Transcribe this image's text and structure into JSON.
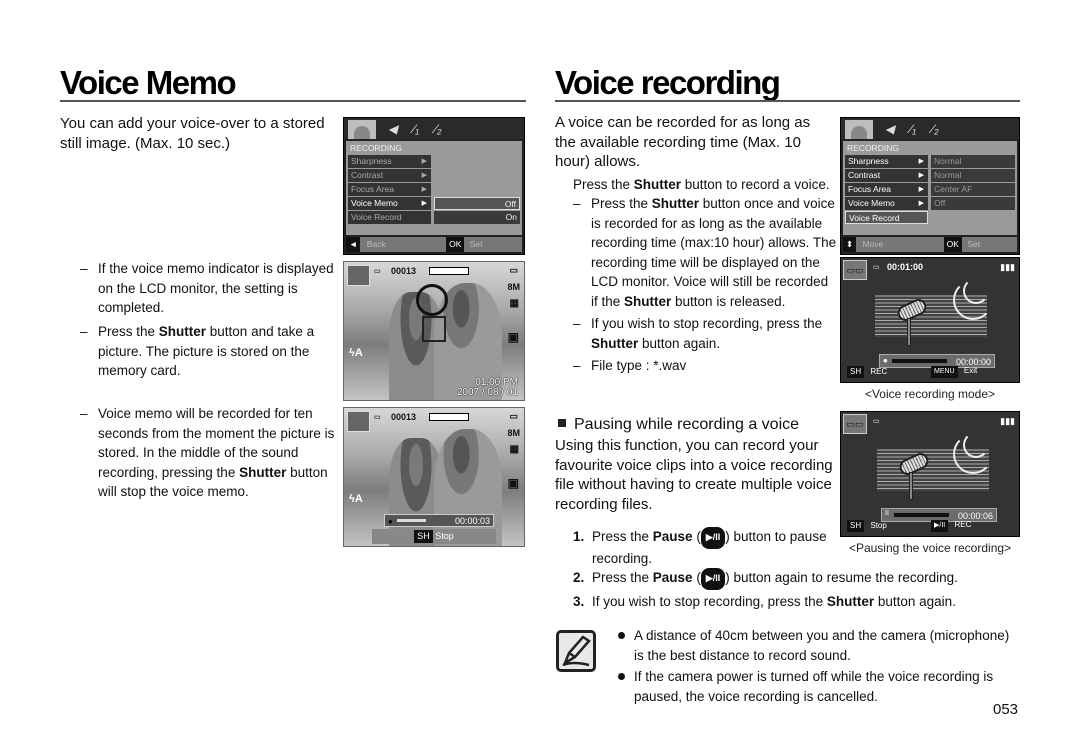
{
  "left": {
    "title": "Voice Memo",
    "intro": "You can add your voice-over to a stored still image. (Max. 10 sec.)",
    "items": [
      {
        "parts": [
          {
            "t": "If the voice memo indicator is displayed on the LCD monitor, the setting is completed."
          }
        ]
      },
      {
        "parts": [
          {
            "t": "Press the "
          },
          {
            "t": "Shutter",
            "b": true
          },
          {
            "t": " button and take a picture. The picture is stored on the memory card."
          }
        ]
      },
      {
        "parts": [
          {
            "t": "Voice memo will be recorded for ten seconds from the moment the picture is stored. In the middle of the sound recording, pressing the "
          },
          {
            "t": "Shutter",
            "b": true
          },
          {
            "t": " button will stop the voice memo."
          }
        ]
      }
    ],
    "menu": {
      "tabs": [
        "camera-tab-icon",
        "sound-tab-icon",
        "setup1-tab-icon",
        "setup2-tab-icon"
      ],
      "section": "RECORDING",
      "rows": [
        "Sharpness",
        "Contrast",
        "Focus Area",
        "Voice Memo",
        "Voice Record"
      ],
      "selected": "Voice Memo",
      "options": [
        "Off",
        "On"
      ],
      "bottom_key": "◄",
      "bottom_label": "Back",
      "ok_key": "OK",
      "ok_label": "Set"
    },
    "screen1": {
      "count": "00013",
      "time": "01:00 PM",
      "date": "2007 / 08 / 01",
      "size": "8M"
    },
    "screen2": {
      "count": "00013",
      "rec_time": "00:00:03",
      "key": "SH",
      "key_label": "Stop",
      "size": "8M",
      "progress": 0.3
    }
  },
  "right": {
    "title": "Voice recording",
    "intro": "A voice can be recorded for as long as the available recording time (Max. 10 hour) allows.",
    "press": [
      {
        "t": "Press the "
      },
      {
        "t": "Shutter",
        "b": true
      },
      {
        "t": " button to record a voice."
      }
    ],
    "items": [
      {
        "parts": [
          {
            "t": "Press the "
          },
          {
            "t": "Shutter",
            "b": true
          },
          {
            "t": " button once and voice is recorded for as long as the available recording time (max:10 hour) allows. The recording time will be displayed on the LCD monitor. Voice will still be recorded if the "
          },
          {
            "t": "Shutter",
            "b": true
          },
          {
            "t": " button is released."
          }
        ]
      },
      {
        "parts": [
          {
            "t": "If you wish to stop recording, press the "
          },
          {
            "t": "Shutter",
            "b": true
          },
          {
            "t": " button again."
          }
        ]
      },
      {
        "parts": [
          {
            "t": "File type : *.wav"
          }
        ]
      }
    ],
    "menu": {
      "section": "RECORDING",
      "rows": [
        "Sharpness",
        "Contrast",
        "Focus Area",
        "Voice Memo",
        "Voice Record"
      ],
      "values": [
        "Normal",
        "Normal",
        "Center AF",
        "Off"
      ],
      "selected": "Voice Record",
      "bottom_key": "⬍",
      "bottom_label": "Move",
      "ok_key": "OK",
      "ok_label": "Set"
    },
    "rec_screen": {
      "remaining": "00:01:00",
      "elapsed": "00:00:00",
      "key1": "SH",
      "key1_label": "REC",
      "key2": "MENU",
      "key2_label": "Exit",
      "caption": "<Voice recording mode>",
      "progress": 0.0
    },
    "subhead": "Pausing while recording a voice",
    "pause_intro": "Using this function, you can record your favourite voice clips into a voice recording file without having to create multiple voice recording files.",
    "steps": [
      {
        "num": "1.",
        "parts": [
          {
            "t": "Press the "
          },
          {
            "t": "Pause",
            "b": true
          },
          {
            "t": " ("
          },
          {
            "key": "▶/II"
          },
          {
            "t": ") button to pause recording."
          }
        ]
      },
      {
        "num": "2.",
        "parts": [
          {
            "t": "Press the "
          },
          {
            "t": "Pause",
            "b": true
          },
          {
            "t": " ("
          },
          {
            "key": "▶/II"
          },
          {
            "t": ") button again to resume the recording."
          }
        ]
      },
      {
        "num": "3.",
        "parts": [
          {
            "t": "If you wish to stop recording, press the "
          },
          {
            "t": "Shutter",
            "b": true
          },
          {
            "t": " button again."
          }
        ]
      }
    ],
    "pause_screen": {
      "elapsed": "00:00:06",
      "key1": "SH",
      "key1_label": "Stop",
      "key2": "▶/II",
      "key2_label": "REC",
      "caption": "<Pausing the voice recording>",
      "progress": 0.05
    },
    "notes": [
      "A distance of 40cm between you and the camera (microphone) is the best distance to record sound.",
      "If the camera power is turned off while the voice recording is paused, the voice recording is cancelled."
    ]
  },
  "page_number": "053"
}
